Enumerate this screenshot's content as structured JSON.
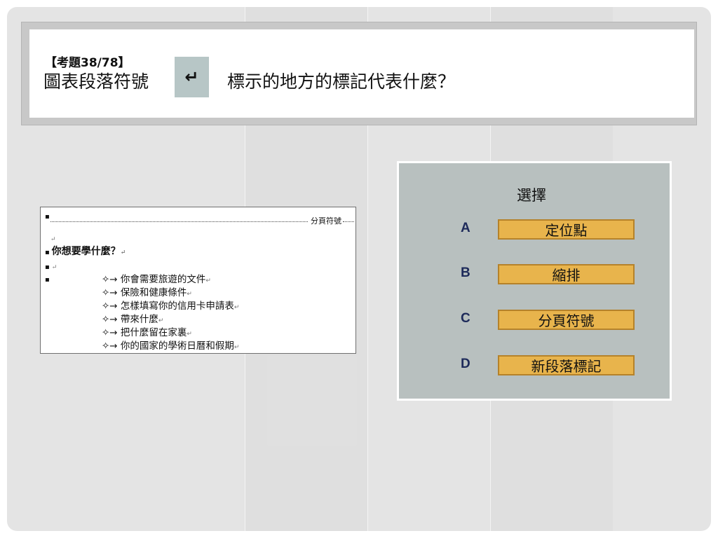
{
  "question": {
    "number": "【考題38/78】",
    "text_before_icon": "圖表段落符號",
    "icon_glyph": "↵",
    "icon_name": "paragraph-mark-icon",
    "text_after_icon": "標示的地方的標記代表什麼？"
  },
  "document": {
    "page_break_label": "分頁符號",
    "heading": "你想要學什麼？",
    "items": [
      "你會需要旅遊的文件",
      "保險和健康條件",
      "怎樣填寫你的信用卡申請表",
      "帶來什麼",
      "把什麼留在家裏",
      "你的國家的學術日曆和假期"
    ],
    "bullet_glyph": "✧→",
    "paragraph_glyph": "↵",
    "square_glyph": "▪"
  },
  "answers": {
    "title": "選擇",
    "options": [
      {
        "letter": "A",
        "label": "定位點"
      },
      {
        "letter": "B",
        "label": "縮排"
      },
      {
        "letter": "C",
        "label": "分頁符號"
      },
      {
        "letter": "D",
        "label": "新段落標記"
      }
    ]
  },
  "colors": {
    "option_fill": "#e8b44c",
    "option_border": "#b5822a",
    "letter_color": "#1d2a5a",
    "panel_bg": "#b8c0bf",
    "icon_bg": "#b7c6c6"
  }
}
